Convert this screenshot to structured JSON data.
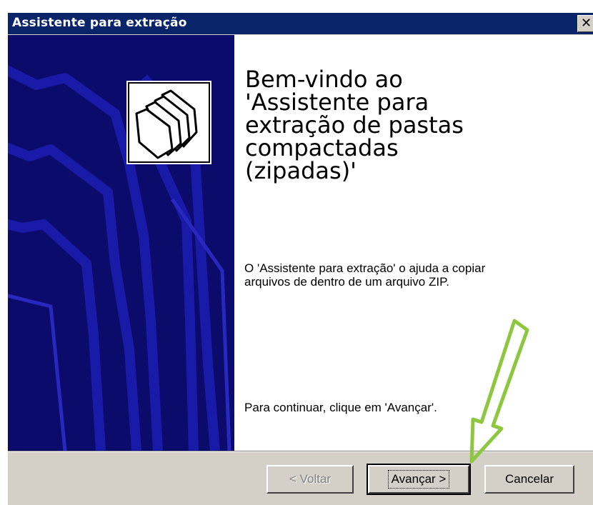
{
  "window": {
    "title": "Assistente para extração",
    "close_label": "✕"
  },
  "icons": {
    "side_art": "folder-outline-art",
    "header": "folder-stack-icon",
    "close": "close-icon",
    "annotation": "green-arrow-annotation"
  },
  "main": {
    "welcome_title": "Bem-vindo ao\n'Assistente para\nextração de pastas\ncompactadas\n(zipadas)'",
    "description": "O 'Assistente para extração' o ajuda a copiar arquivos de dentro de um arquivo ZIP.",
    "continue_text": "Para continuar, clique em 'Avançar'."
  },
  "buttons": {
    "back_label": "< Voltar",
    "next_label": "Avançar >",
    "cancel_label": "Cancelar"
  },
  "colors": {
    "titlebar": "#0a246a",
    "side_panel": "#0b0b6b",
    "dialog_face": "#d4d0c8",
    "annotation_arrow": "#8dc63f"
  }
}
